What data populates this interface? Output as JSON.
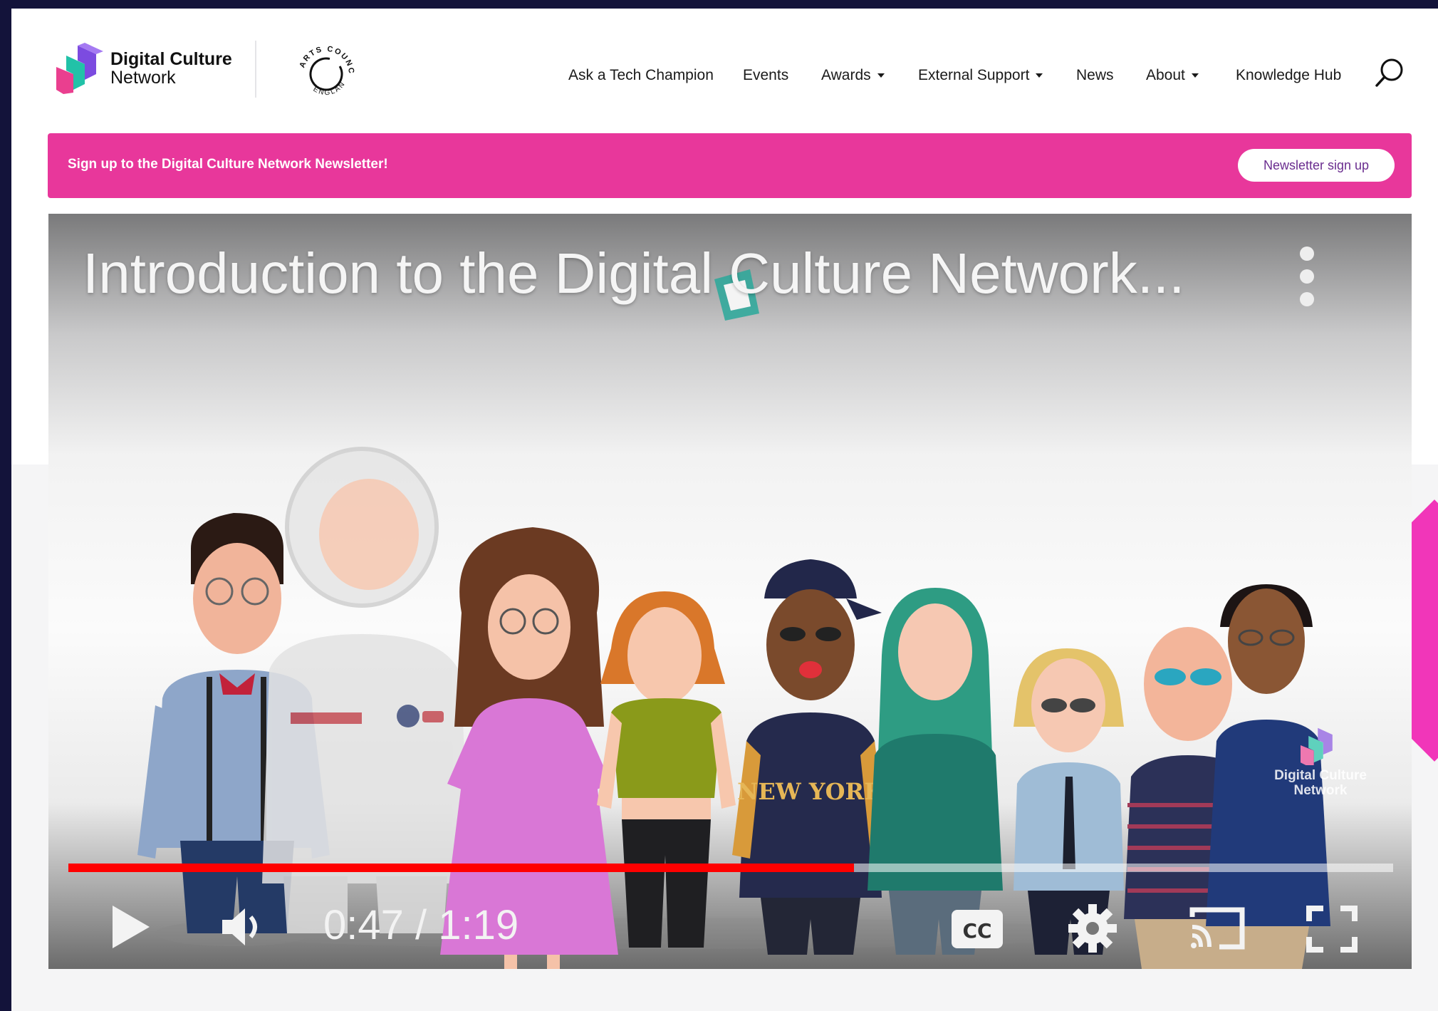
{
  "header": {
    "logo_line1": "Digital Culture",
    "logo_line2": "Network",
    "partner_logo_top": "ARTS COUNCIL",
    "partner_logo_bottom": "ENGLAND"
  },
  "nav": {
    "items": [
      {
        "label": "Ask a Tech Champion",
        "dropdown": false
      },
      {
        "label": "Events",
        "dropdown": false
      },
      {
        "label": "Awards",
        "dropdown": true
      },
      {
        "label": "External Support",
        "dropdown": true
      },
      {
        "label": "News",
        "dropdown": false
      },
      {
        "label": "About",
        "dropdown": true
      },
      {
        "label": "Knowledge Hub",
        "dropdown": false
      }
    ],
    "search_icon": "search-icon"
  },
  "banner": {
    "text": "Sign up to the Digital Culture Network Newsletter!",
    "button": "Newsletter sign up"
  },
  "video": {
    "title": "Introduction to the Digital Culture Network...",
    "time": "0:47 / 1:19",
    "progress_fraction": 0.593,
    "watermark_line1": "Digital Culture",
    "watermark_line2": "Network",
    "jacket_text": "NEW YORK",
    "controls": [
      "play-icon",
      "volume-icon",
      "captions-icon",
      "settings-icon",
      "cast-icon",
      "fullscreen-icon"
    ]
  },
  "colors": {
    "brand_pink": "#e8379b",
    "accent_magenta": "#f136b9",
    "frame_navy": "#13133a",
    "progress_red": "#ff0000",
    "button_text_purple": "#6a2d8f"
  }
}
